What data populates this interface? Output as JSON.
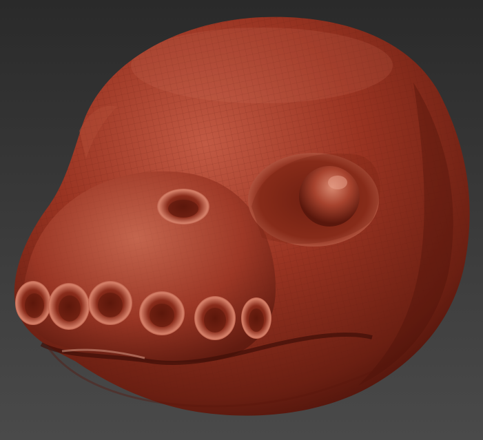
{
  "scene": {
    "subject": "sculpted-creature-head",
    "background_top_color": "#2a2a2a",
    "background_bottom_color": "#4a4a4a",
    "material_color": "#9a3422",
    "material_highlight_color": "#d2735c",
    "material_shadow_color": "#4a120a",
    "wireframe_color": "#5e1a0f"
  }
}
